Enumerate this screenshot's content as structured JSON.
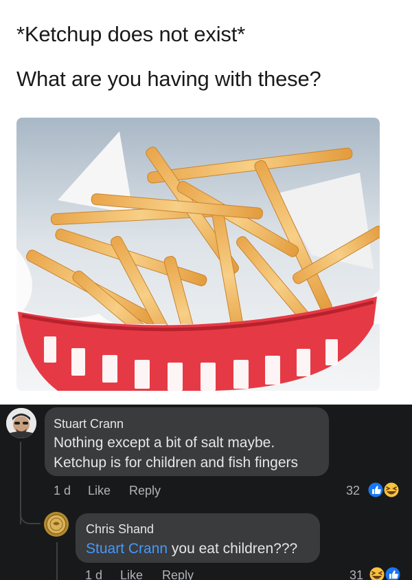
{
  "post": {
    "line1": "*Ketchup does not exist*",
    "line2": "What are you having with these?",
    "image_icon": "french-fries-basket-image"
  },
  "comments": [
    {
      "author": "Stuart Crann",
      "text_line1": "Nothing except a bit of salt maybe.",
      "text_line2": "Ketchup is for children and fish fingers",
      "time": "1 d",
      "like_label": "Like",
      "reply_label": "Reply",
      "reaction_count": "32",
      "reactions": [
        "like-icon",
        "haha-icon"
      ]
    },
    {
      "author": "Chris Shand",
      "mention": "Stuart Crann",
      "text": " you eat children???",
      "time": "1 d",
      "like_label": "Like",
      "reply_label": "Reply",
      "reaction_count": "31",
      "reactions": [
        "haha-icon",
        "like-icon"
      ]
    }
  ],
  "colors": {
    "dark_bg": "#18191a",
    "bubble": "#3a3b3c",
    "text": "#e4e6eb",
    "meta": "#b0b3b8",
    "mention": "#4599ff",
    "like_blue": "#1877f2",
    "haha_yellow": "#f7c23e",
    "basket_red": "#e53a45"
  }
}
